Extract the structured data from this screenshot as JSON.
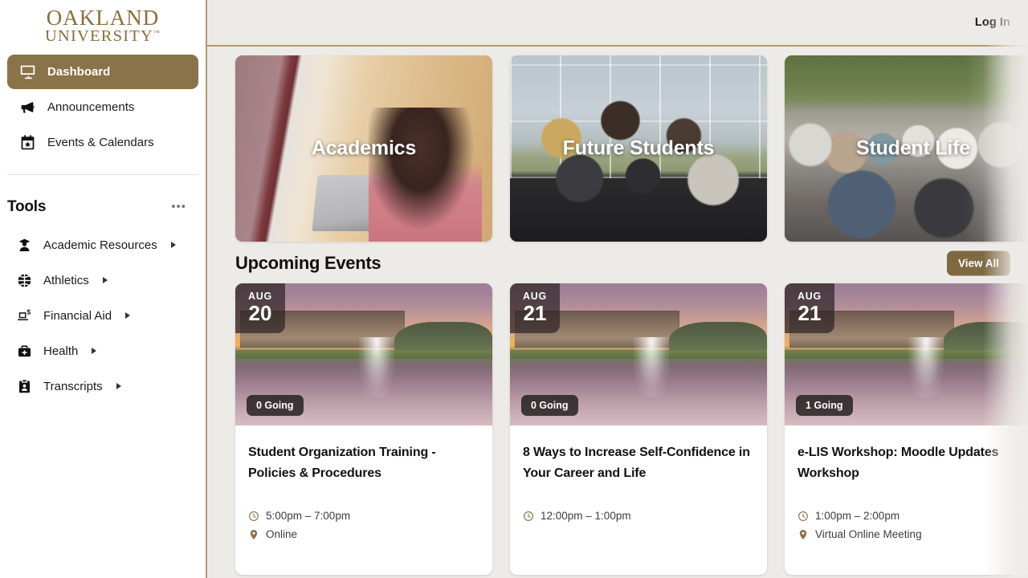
{
  "brand": {
    "logo_line1": "OAKLAND",
    "logo_line2": "UNIVERSITY",
    "accent_gold": "#8a6d3b",
    "accent_brown": "#8a7249",
    "button_brown": "#7d6942",
    "page_bg": "#edebe7"
  },
  "header": {
    "login_label": "Log In"
  },
  "sidebar": {
    "nav": [
      {
        "label": "Dashboard",
        "icon": "dashboard-icon",
        "active": true
      },
      {
        "label": "Announcements",
        "icon": "megaphone-icon",
        "active": false
      },
      {
        "label": "Events & Calendars",
        "icon": "calendar-star-icon",
        "active": false
      }
    ],
    "tools_heading": "Tools",
    "tools_menu_glyph": "•••",
    "tools": [
      {
        "label": "Academic Resources",
        "icon": "graduate-person-icon"
      },
      {
        "label": "Athletics",
        "icon": "basketball-icon"
      },
      {
        "label": "Financial Aid",
        "icon": "laptop-dollar-icon"
      },
      {
        "label": "Health",
        "icon": "medical-bag-icon"
      },
      {
        "label": "Transcripts",
        "icon": "clipboard-person-icon"
      }
    ]
  },
  "tiles": [
    {
      "label": "Academics",
      "photo": "ph-academics"
    },
    {
      "label": "Future Students",
      "photo": "ph-future"
    },
    {
      "label": "Student Life",
      "photo": "ph-life"
    }
  ],
  "events_section": {
    "title": "Upcoming Events",
    "view_all_label": "View All"
  },
  "events": [
    {
      "month": "AUG",
      "day": "20",
      "going": "0 Going",
      "title": "Student Organization Training - Policies & Procedures",
      "time": "5:00pm – 7:00pm",
      "location": "Online"
    },
    {
      "month": "AUG",
      "day": "21",
      "going": "0 Going",
      "title": "8 Ways to Increase Self-Confidence in Your Career and Life",
      "time": "12:00pm – 1:00pm",
      "location": ""
    },
    {
      "month": "AUG",
      "day": "21",
      "going": "1 Going",
      "title": "e-LIS Workshop: Moodle Updates Workshop",
      "time": "1:00pm – 2:00pm",
      "location": "Virtual Online Meeting"
    }
  ]
}
